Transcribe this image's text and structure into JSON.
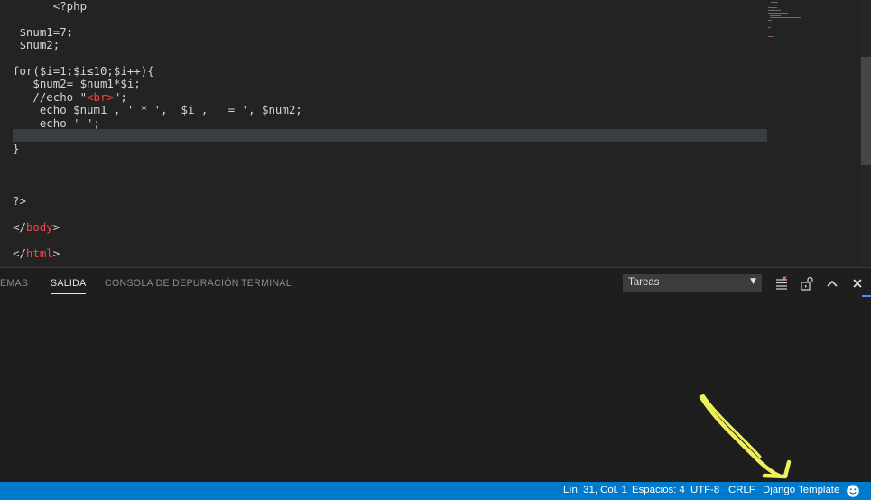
{
  "editor": {
    "lines": [
      {
        "segments": [
          {
            "t": "      <?php",
            "k": "punc"
          }
        ]
      },
      {
        "segments": []
      },
      {
        "segments": [
          {
            "t": " $num1=7;",
            "k": "punc"
          }
        ]
      },
      {
        "segments": [
          {
            "t": " $num2;",
            "k": "punc"
          }
        ]
      },
      {
        "segments": []
      },
      {
        "segments": [
          {
            "t": "for($i=1;$i≤10;$i++){",
            "k": "punc"
          }
        ]
      },
      {
        "segments": [
          {
            "t": "   $num2= $num1*$i;",
            "k": "punc"
          }
        ]
      },
      {
        "segments": [
          {
            "t": "   //echo \"",
            "k": "punc"
          },
          {
            "t": "<br>",
            "k": "tag"
          },
          {
            "t": "\";",
            "k": "punc"
          }
        ]
      },
      {
        "segments": [
          {
            "t": "    echo $num1 , ' * ',  $i , ' = ', $num2;",
            "k": "punc"
          }
        ]
      },
      {
        "segments": [
          {
            "t": "    echo ' ';",
            "k": "punc"
          }
        ]
      },
      {
        "segments": []
      },
      {
        "segments": [
          {
            "t": "}",
            "k": "punc"
          }
        ]
      },
      {
        "segments": []
      },
      {
        "segments": []
      },
      {
        "segments": []
      },
      {
        "segments": [
          {
            "t": "?>",
            "k": "punc"
          }
        ]
      },
      {
        "segments": []
      },
      {
        "segments": [
          {
            "t": "</",
            "k": "punc"
          },
          {
            "t": "body",
            "k": "tag"
          },
          {
            "t": ">",
            "k": "punc"
          }
        ]
      },
      {
        "segments": []
      },
      {
        "segments": [
          {
            "t": "</",
            "k": "punc"
          },
          {
            "t": "html",
            "k": "tag"
          },
          {
            "t": ">",
            "k": "punc"
          }
        ]
      }
    ]
  },
  "panel": {
    "tabs": [
      {
        "label": "EMAS",
        "active": false
      },
      {
        "label": "SALIDA",
        "active": true
      },
      {
        "label": "CONSOLA DE DEPURACIÓN",
        "active": false
      },
      {
        "label": "TERMINAL",
        "active": false
      }
    ],
    "output_channel": "Tareas",
    "icons": [
      "clear-output-icon",
      "lock-scroll-icon",
      "maximize-panel-icon",
      "close-panel-icon"
    ]
  },
  "statusbar": {
    "position": "Lín. 31, Col. 1",
    "indentation": "Espacios: 4",
    "encoding": "UTF-8",
    "eol": "CRLF",
    "language": "Django Template",
    "feedback_icon": "smiley-icon"
  },
  "colors": {
    "statusbar": "#007acc",
    "editor_bg": "#232323",
    "panel_bg": "#1e1e1e",
    "annotation": "#f0f05a",
    "tag": "#f44747"
  }
}
